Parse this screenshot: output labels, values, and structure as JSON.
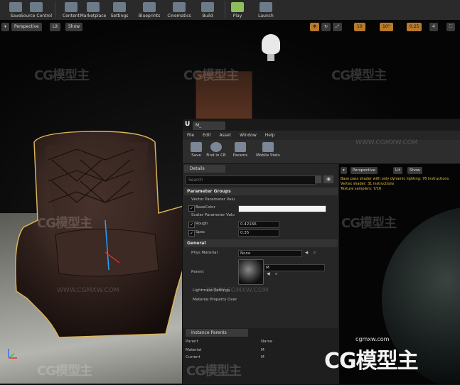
{
  "toolbar": {
    "items": [
      {
        "label": "Save",
        "icon": "save-icon"
      },
      {
        "label": "Source Control",
        "icon": "source-control-icon"
      },
      {
        "label": "Content",
        "icon": "content-icon"
      },
      {
        "label": "Marketplace",
        "icon": "marketplace-icon"
      },
      {
        "label": "Settings",
        "icon": "settings-icon"
      },
      {
        "label": "Blueprints",
        "icon": "blueprints-icon"
      },
      {
        "label": "Cinematics",
        "icon": "cinematics-icon"
      },
      {
        "label": "Build",
        "icon": "build-icon"
      },
      {
        "label": "Play",
        "icon": "play-icon"
      },
      {
        "label": "Launch",
        "icon": "launch-icon"
      }
    ]
  },
  "viewport": {
    "perspective_label": "Perspective",
    "lit_label": "Lit",
    "show_label": "Show",
    "grid_snap": "10",
    "rot_snap": "10°",
    "scale_snap": "0.25",
    "cam_speed": "4"
  },
  "material_editor": {
    "tab_label": "M_",
    "menu": [
      "File",
      "Edit",
      "Asset",
      "Window",
      "Help"
    ],
    "tools": [
      {
        "label": "Save",
        "icon": "save-icon"
      },
      {
        "label": "Find in CB",
        "icon": "find-in-cb-icon"
      },
      {
        "label": "Params",
        "icon": "params-icon"
      },
      {
        "label": "Mobile Stats",
        "icon": "mobile-stats-icon"
      }
    ],
    "details": {
      "tab_label": "Details",
      "search_placeholder": "Search",
      "parameter_groups": "Parameter Groups",
      "vector_params": "Vector Parameter Valu",
      "base_color_label": "BaseColor",
      "scalar_params": "Scalar Parameter Valu",
      "rough_label": "Rough",
      "rough_value": "0.42166",
      "spec_label": "Spec",
      "spec_value": "0.35",
      "general": "General",
      "phys_material_label": "Phys Material",
      "phys_material_value": "None",
      "parent_label": "Parent",
      "parent_value": "M",
      "lightmass_label": "Lightmass Settings",
      "material_property_label": "Material Property Over"
    },
    "instance_parents": {
      "tab_label": "Instance Parents",
      "col_parent": "Parent",
      "col_name": "Name",
      "rows": [
        {
          "parent": "Material",
          "name": "M"
        },
        {
          "parent": "Current",
          "name": "M"
        }
      ]
    },
    "preview": {
      "perspective_label": "Perspective",
      "lit_label": "Lit",
      "show_label": "Show",
      "stats_line1": "Base pass shader with only dynamic lighting: 76 instructions",
      "stats_line2": "Vertex shader: 31 instructions",
      "stats_line3": "Texture samplers: 7/16"
    }
  },
  "watermarks": {
    "brand": "CG模型主",
    "url": "WWW.CGMXW.COM",
    "small_url": "cgmxw.com"
  }
}
